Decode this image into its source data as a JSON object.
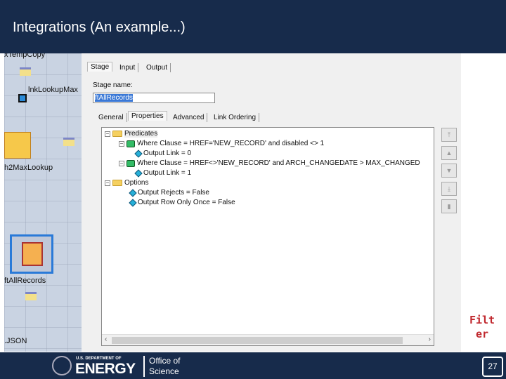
{
  "slide": {
    "title": "Integrations (An example...)",
    "filter_label_1": "Filt",
    "filter_label_2": "er",
    "page_number": "27"
  },
  "footer": {
    "dept": "U.S. DEPARTMENT OF",
    "energy": "ENERGY",
    "office_1": "Office of",
    "office_2": "Science"
  },
  "canvas": {
    "labels": [
      "xTempCopy",
      "lnkLookupMax",
      "h2MaxLookup",
      "ftAllRecords",
      ".JSON"
    ]
  },
  "dialog": {
    "top_tabs": [
      "Stage",
      "Input",
      "Output"
    ],
    "stage_name_label": "Stage name:",
    "stage_name_value": "ftAllRecords",
    "sub_tabs": [
      "General",
      "Properties",
      "Advanced",
      "Link Ordering"
    ],
    "tree": {
      "predicates": "Predicates",
      "where1": "Where Clause = HREF='NEW_RECORD' and disabled <> 1",
      "link0": "Output Link = 0",
      "where2": "Where Clause = HREF<>'NEW_RECORD' and ARCH_CHANGEDATE > MAX_CHANGED",
      "link1": "Output Link = 1",
      "options": "Options",
      "rejects": "Output Rejects = False",
      "once": "Output Row Only Once = False"
    }
  }
}
